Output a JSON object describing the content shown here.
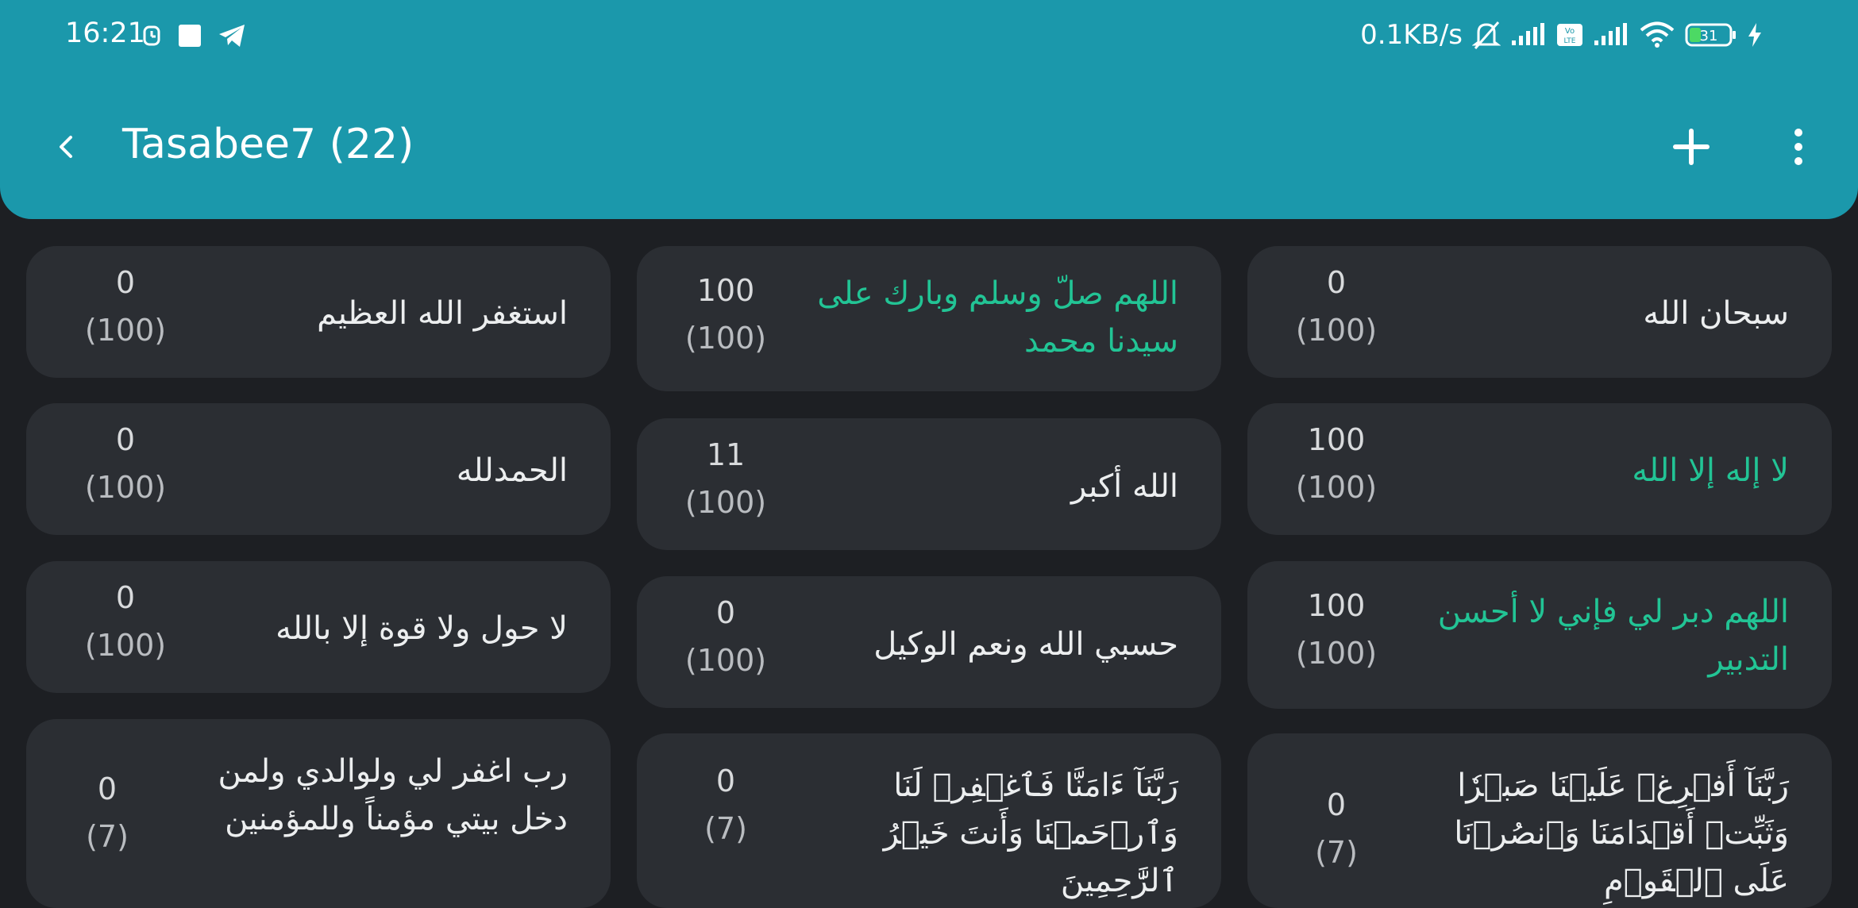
{
  "status_bar": {
    "time": "16:21",
    "speed": "0.1KB/s",
    "battery": "31",
    "icons": [
      "alarm-icon",
      "screen-record-icon",
      "telegram-icon",
      "mute-icon",
      "signal-icon",
      "volte-icon",
      "signal-icon",
      "wifi-icon",
      "battery-icon",
      "charging-icon"
    ]
  },
  "toolbar": {
    "title": "Tasabee7 (22)",
    "back_icon": "chevron-left-icon",
    "add_icon": "plus-icon",
    "menu_icon": "more-vertical-icon"
  },
  "colors": {
    "appbar": "#1b98ab",
    "background": "#1d1f23",
    "card": "#2b2e33",
    "completed_text": "#22c495"
  },
  "cards": [
    {
      "text": "سبحان الله",
      "count": "0",
      "target": "(100)",
      "completed": false
    },
    {
      "text": "اللهم صلّ وسلم وبارك على سيدنا محمد",
      "count": "100",
      "target": "(100)",
      "completed": true
    },
    {
      "text": "استغفر الله العظيم",
      "count": "0",
      "target": "(100)",
      "completed": false
    },
    {
      "text": "لا إله إلا الله",
      "count": "100",
      "target": "(100)",
      "completed": true
    },
    {
      "text": "الله أكبر",
      "count": "11",
      "target": "(100)",
      "completed": false
    },
    {
      "text": "الحمدلله",
      "count": "0",
      "target": "(100)",
      "completed": false
    },
    {
      "text": "اللهم دبر لي فإني لا أحسن التدبير",
      "count": "100",
      "target": "(100)",
      "completed": true
    },
    {
      "text": "حسبي الله ونعم الوكيل",
      "count": "0",
      "target": "(100)",
      "completed": false
    },
    {
      "text": "لا حول ولا قوة إلا بالله",
      "count": "0",
      "target": "(100)",
      "completed": false
    },
    {
      "text": "رَبَّنَآ أَفۡرِغۡ عَلَيۡنَا صَبۡرٗا وَثَبِّتۡ أَقۡدَامَنَا وَٱنصُرۡنَا عَلَى ٱلۡقَوۡمِ",
      "count": "0",
      "target": "(7)",
      "completed": false
    },
    {
      "text": "رَبَّنَآ ءَامَنَّا فَٱغۡفِرۡ لَنَا وَٱرۡحَمۡنَا وَأَنتَ خَيۡرُ ٱلرَّٰحِمِينَ",
      "count": "0",
      "target": "(7)",
      "completed": false
    },
    {
      "text": "رب اغفر لي ولوالدي ولمن دخل بيتي مؤمناً وللمؤمنين",
      "count": "0",
      "target": "(7)",
      "completed": false
    }
  ]
}
